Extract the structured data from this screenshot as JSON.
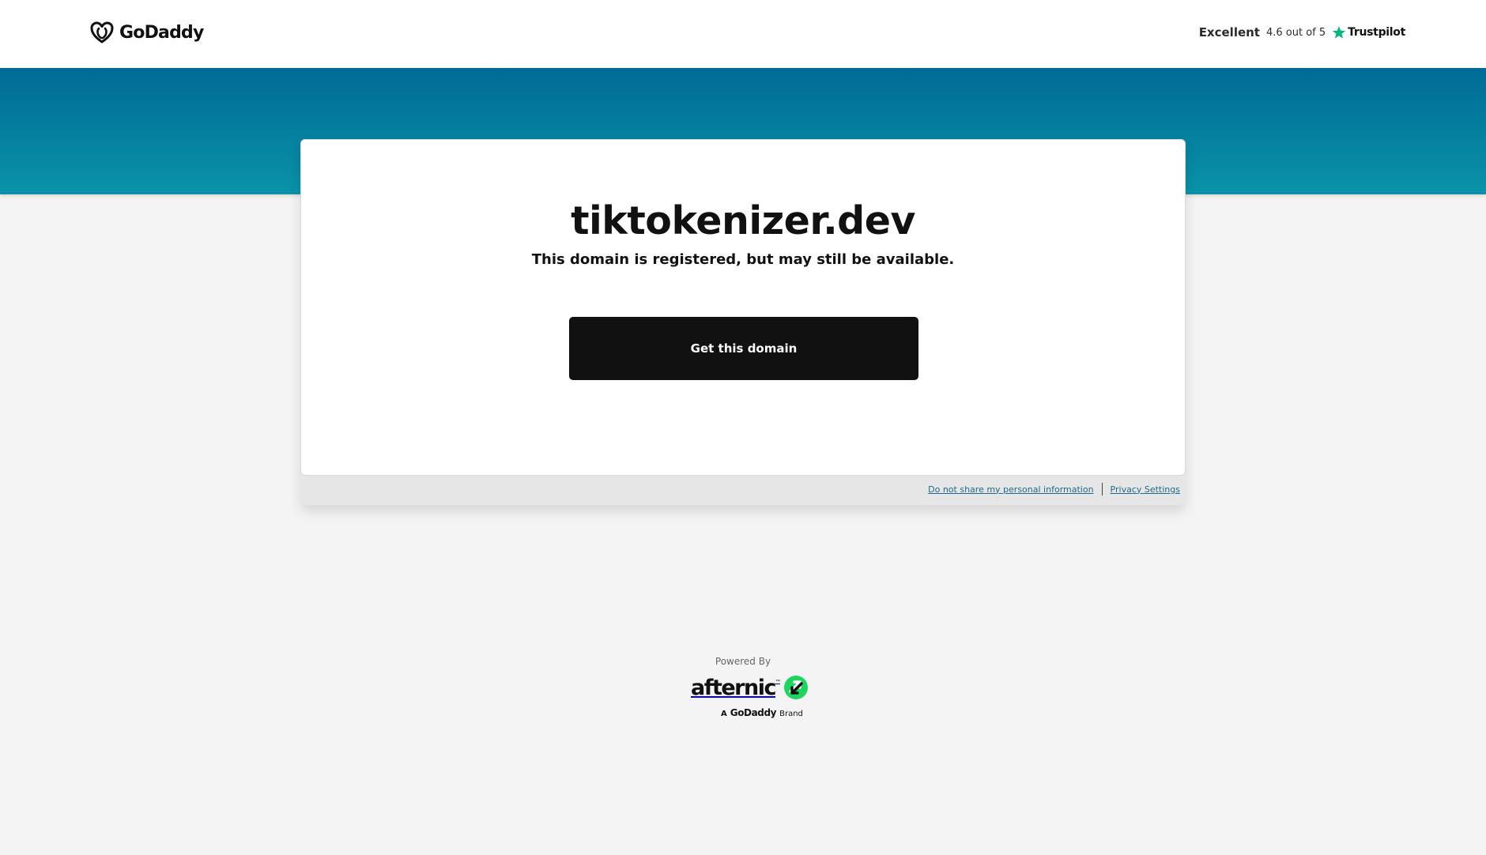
{
  "header": {
    "logo_text": "GoDaddy",
    "trust": {
      "rating_word": "Excellent",
      "score": "4.6 out of 5",
      "brand": "Trustpilot"
    }
  },
  "card": {
    "domain": "tiktokenizer.dev",
    "status": "This domain is registered, but may still be available.",
    "cta_label": "Get this domain"
  },
  "legal": {
    "do_not_share": "Do not share my personal information",
    "privacy": "Privacy Settings"
  },
  "footer": {
    "powered_by": "Powered By",
    "afternic": "afternic",
    "brand_prefix": "A",
    "brand_name": "GoDaddy",
    "brand_suffix": "Brand"
  },
  "colors": {
    "band_top": "#006b96",
    "band_bottom": "#0a93a8",
    "cta_bg": "#111111",
    "trustpilot_star": "#00b67a",
    "afternic_green": "#1ed65f"
  }
}
